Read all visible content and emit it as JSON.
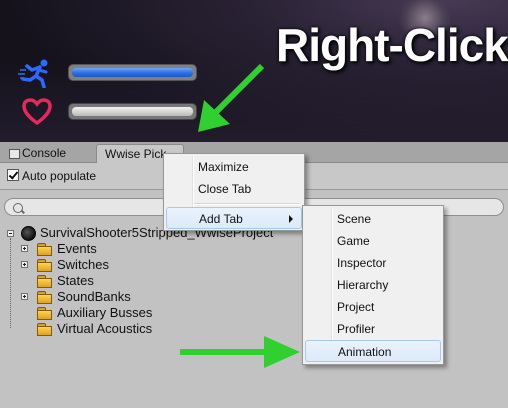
{
  "callout": {
    "text": "Right-Click"
  },
  "hud": {
    "stamina_level": 1.0,
    "health_level": 1.0,
    "stamina_color": "#2d6fe3",
    "health_color": "#e0e0e0",
    "heart_color": "#e8285a",
    "arrow_color": "#2fd02f"
  },
  "tabs": {
    "console": "Console",
    "wwise": "Wwise Pick"
  },
  "toolbar": {
    "auto_populate": "Auto populate",
    "auto_populate_checked": true
  },
  "search": {
    "placeholder": ""
  },
  "tree": {
    "root": "SurvivalShooter5Stripped_WwiseProject",
    "items": [
      {
        "label": "Events",
        "expandable": true
      },
      {
        "label": "Switches",
        "expandable": true
      },
      {
        "label": "States",
        "expandable": false
      },
      {
        "label": "SoundBanks",
        "expandable": true
      },
      {
        "label": "Auxiliary Busses",
        "expandable": false
      },
      {
        "label": "Virtual Acoustics",
        "expandable": false
      }
    ]
  },
  "context_menu": {
    "items": [
      "Maximize",
      "Close Tab"
    ],
    "add_tab": "Add Tab"
  },
  "add_tab_menu": {
    "items": [
      "Scene",
      "Game",
      "Inspector",
      "Hierarchy",
      "Project",
      "Profiler",
      "Animation"
    ],
    "highlighted": "Animation"
  }
}
